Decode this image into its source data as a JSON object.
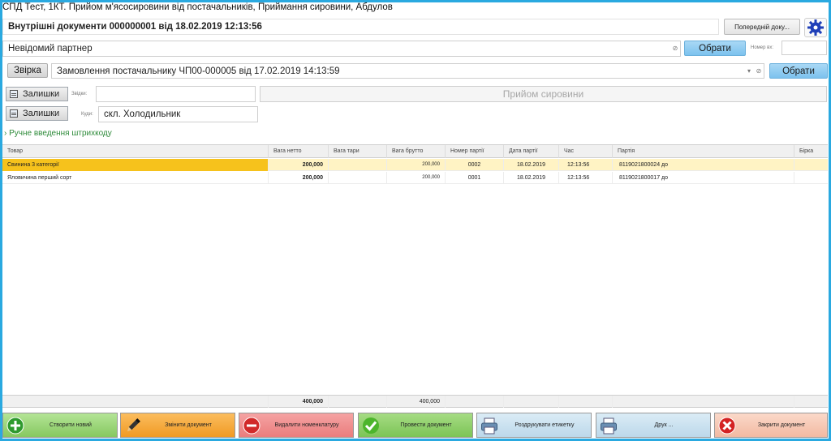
{
  "window": {
    "title": "СПД Тест, 1КТ. Прийом м'ясосировини від постачальників, Приймання сировини, Абдулов"
  },
  "header": {
    "document_title": "Внутрішні документи 000000001 від 18.02.2019 12:13:56",
    "prev_doc_label": "Попередній доку..."
  },
  "partner": {
    "value": "Невідомий партнер",
    "select_label": "Обрати",
    "incoming_number_label": "Номер вх:",
    "incoming_number_value": ""
  },
  "order": {
    "reconcile_label": "Звірка",
    "value": "Замовлення постачальнику ЧП00-000005 від 17.02.2019 14:13:59",
    "select_label": "Обрати"
  },
  "from": {
    "stock_label": "Залишки",
    "field_label": "Звідки:",
    "value": "",
    "operation_label": "Прийом сировини"
  },
  "to": {
    "stock_label": "Залишки",
    "field_label": "Куди:",
    "value": "скл. Холодильник"
  },
  "barcode_link": "Ручне введення штрихкоду",
  "table": {
    "columns": [
      "Товар",
      "Вага нетто",
      "Вага тари",
      "Вага брутто",
      "Номер партії",
      "Дата партії",
      "Час",
      "Партія",
      "Бірка"
    ],
    "rows": [
      {
        "product": "Свинина 3 категорії",
        "net": "200,000",
        "tare": "",
        "gross": "200,000",
        "batch_no": "0002",
        "batch_date": "18.02.2019",
        "time": "12:13:56",
        "batch": "8119021800024 до",
        "tag": ""
      },
      {
        "product": "Яловичина перший сорт",
        "net": "200,000",
        "tare": "",
        "gross": "200,000",
        "batch_no": "0001",
        "batch_date": "18.02.2019",
        "time": "12:13:56",
        "batch": "8119021800017 до",
        "tag": ""
      }
    ],
    "totals": {
      "net": "400,000",
      "gross": "400,000"
    }
  },
  "toolbar": {
    "create": "Створити новий",
    "edit": "Змінити документ",
    "delete": "Видалити номенклатуру",
    "post": "Провести документ",
    "print_label": "Роздрукувати етикетку",
    "print": "Друк ...",
    "close": "Закрити документ"
  },
  "colors": {
    "frame": "#2aa9e0",
    "selected_row": "#fff3c4",
    "selected_cell": "#f6c21c",
    "create_bg": "#9ed67a",
    "edit_bg": "#f7a33a",
    "delete_bg": "#ef8a8a",
    "post_bg": "#8fd06a",
    "print_bg": "#cde3f0",
    "close_bg": "#f6c8b4"
  }
}
